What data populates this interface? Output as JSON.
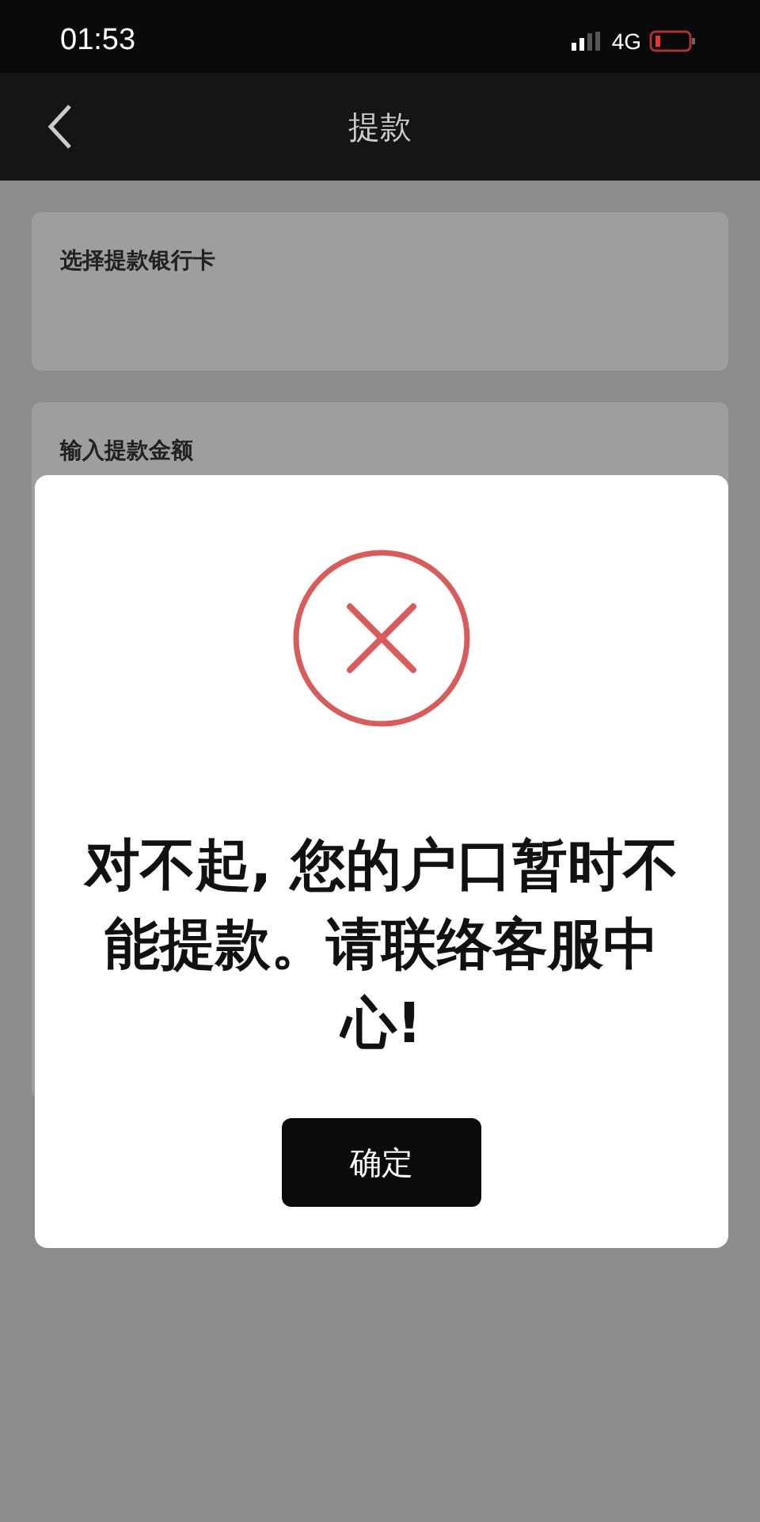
{
  "status_bar": {
    "time": "01:53",
    "network": "4G"
  },
  "nav_bar": {
    "title": "提款"
  },
  "cards": [
    {
      "label": "选择提款银行卡"
    },
    {
      "label": "输入提款金额"
    }
  ],
  "dialog": {
    "message": "对不起, 您的户口暂时不能提款。请联络客服中心!",
    "button": "确定"
  }
}
